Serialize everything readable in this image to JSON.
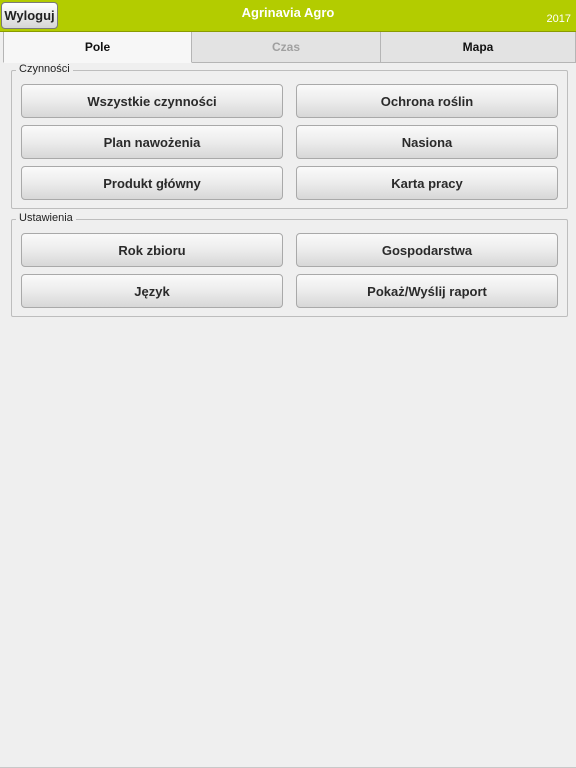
{
  "header": {
    "logout_label": "Wyloguj",
    "title": "Agrinavia Agro",
    "year": "2017",
    "bg_color": "#b3cc00"
  },
  "tabs": [
    {
      "label": "Pole",
      "state": "active"
    },
    {
      "label": "Czas",
      "state": "disabled"
    },
    {
      "label": "Mapa",
      "state": "normal"
    }
  ],
  "activities": {
    "legend": "Czynności",
    "buttons": [
      "Wszystkie czynności",
      "Ochrona roślin",
      "Plan nawożenia",
      "Nasiona",
      "Produkt główny",
      "Karta pracy"
    ]
  },
  "settings": {
    "legend": "Ustawienia",
    "buttons": [
      "Rok zbioru",
      "Gospodarstwa",
      "Język",
      "Pokaż/Wyślij raport"
    ]
  }
}
